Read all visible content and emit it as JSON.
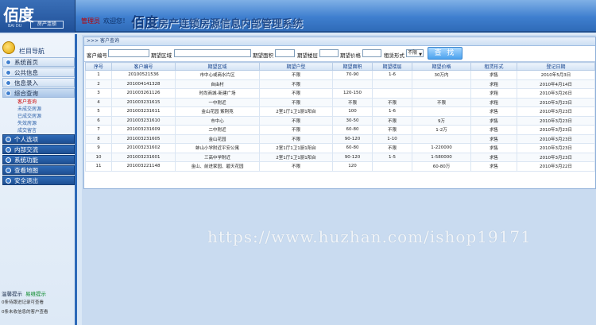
{
  "header": {
    "logo_main": "佰度",
    "logo_tag": "房产连锁",
    "logo_sub": "BAI DU",
    "welcome_user": "管理员",
    "welcome_text": "欢迎您！",
    "title_brand": "佰度",
    "title_text": "房产连锁房源信息内部管理系统"
  },
  "sidebar": {
    "nav_title": "栏目导航",
    "items": [
      {
        "label": "系统首页"
      },
      {
        "label": "公共信息"
      },
      {
        "label": "信息录入"
      },
      {
        "label": "综合查询"
      }
    ],
    "subitems": [
      {
        "label": "客户查询"
      },
      {
        "label": "未成交房源"
      },
      {
        "label": "已成交房源"
      },
      {
        "label": "失效房源"
      },
      {
        "label": "成交留言"
      }
    ],
    "items2": [
      {
        "label": "个人选项"
      },
      {
        "label": "内部交流"
      },
      {
        "label": "系统功能"
      },
      {
        "label": "查看地图"
      },
      {
        "label": "安全退出"
      }
    ],
    "tips_title": "温馨提示",
    "tips_title_green": "易维提示",
    "tips": [
      "0条待跟进记录可查看",
      "0条未收信息的客户查看"
    ]
  },
  "breadcrumb": ">>> 客户查询",
  "search": {
    "label_client": "客户编号",
    "label_area": "期望区域",
    "label_size": "期望面积",
    "label_floor": "期望楼层",
    "label_price": "期望价格",
    "label_type": "租赁形式",
    "type_value": "不限",
    "button": "查 找"
  },
  "table": {
    "headers": [
      "序号",
      "客户编号",
      "期望区域",
      "期望户型",
      "期望面积",
      "期望楼层",
      "期望价格",
      "租赁形式",
      "登记日期"
    ],
    "rows": [
      [
        "1",
        "20100521536",
        "市中心或商水片区",
        "不限",
        "70-90",
        "1-6",
        "30万内",
        "求售",
        "2010年5月3日"
      ],
      [
        "2",
        "201004141328",
        "自由村",
        "不限",
        "",
        "",
        "",
        "求租",
        "2010年4月14日"
      ],
      [
        "3",
        "201003261126",
        "时尚商城-新建广场",
        "不限",
        "120-150",
        "",
        "",
        "求租",
        "2010年3月26日"
      ],
      [
        "4",
        "201003231615",
        "一中附近",
        "不限",
        "不限",
        "不限",
        "不限",
        "求租",
        "2010年3月23日"
      ],
      [
        "5",
        "201003231611",
        "金山花园 紫荆苑 ",
        "2室1厅1卫1厨1阳台",
        "100",
        "1-6",
        "",
        "求售",
        "2010年3月23日"
      ],
      [
        "6",
        "201003231610",
        "市中心",
        "不限",
        "30-50",
        "不限",
        "9万",
        "求售",
        "2010年3月23日"
      ],
      [
        "7",
        "201003231609",
        "二中附近",
        "不限",
        "60-80",
        "不限",
        "1-2万",
        "求售",
        "2010年3月23日"
      ],
      [
        "8",
        "201003231605",
        "金山花园",
        "不限",
        "90-120",
        "1-10",
        "",
        "求售",
        "2010年3月23日"
      ],
      [
        "9",
        "201003231602",
        "蚌山小学附近平安公寓",
        "2室1厅1卫1厨1阳台",
        "60-80",
        "不限",
        "1-220000",
        "求售",
        "2010年3月23日"
      ],
      [
        "10",
        "201003231601",
        "三高中学附近",
        "2室1厅1卫1厨1阳台",
        "90-120",
        "1-5",
        "1-580000",
        "求售",
        "2010年3月23日"
      ],
      [
        "11",
        "201003221148",
        "金山、前进家园、碧天花园",
        "不限",
        "120",
        "",
        "60-80万",
        "求售",
        "2010年3月22日"
      ]
    ]
  },
  "watermark": "https://www.huzhan.com/ishop19171"
}
